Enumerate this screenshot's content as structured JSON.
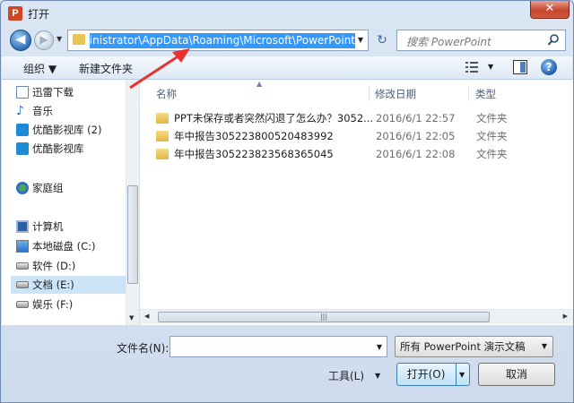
{
  "window": {
    "title": "打开",
    "app_icon_letter": "P",
    "close_symbol": "✕"
  },
  "nav": {
    "back_symbol": "◀",
    "forward_symbol": "▶",
    "address": "C:\\Users\\Administrator\\AppData\\Roaming\\Microsoft\\PowerPoint",
    "refresh_symbol": "↻",
    "search_placeholder": "搜索 PowerPoint"
  },
  "toolbar": {
    "organize_label": "组织 ▼",
    "new_folder_label": "新建文件夹",
    "help_symbol": "?"
  },
  "sidebar": {
    "items": [
      {
        "label": "迅雷下载",
        "icon": "document-icon"
      },
      {
        "label": "音乐",
        "icon": "music-icon"
      },
      {
        "label": "优酷影视库 (2)",
        "icon": "video-icon"
      },
      {
        "label": "优酷影视库",
        "icon": "video-icon"
      },
      {
        "label": "家庭组",
        "icon": "homegroup-icon"
      },
      {
        "label": "计算机",
        "icon": "computer-icon"
      },
      {
        "label": "本地磁盘 (C:)",
        "icon": "system-drive-icon"
      },
      {
        "label": "软件 (D:)",
        "icon": "drive-icon"
      },
      {
        "label": "文档 (E:)",
        "icon": "drive-icon",
        "selected": true
      },
      {
        "label": "娱乐 (F:)",
        "icon": "drive-icon"
      }
    ]
  },
  "filelist": {
    "columns": [
      "名称",
      "修改日期",
      "类型"
    ],
    "rows": [
      {
        "name": "PPT未保存或者突然闪退了怎么办？3052...",
        "date": "2016/6/1 22:57",
        "type": "文件夹"
      },
      {
        "name": "年中报告305223800520483992",
        "date": "2016/6/1 22:05",
        "type": "文件夹"
      },
      {
        "name": "年中报告305223823568365045",
        "date": "2016/6/1 22:08",
        "type": "文件夹"
      }
    ]
  },
  "bottom": {
    "filename_label": "文件名(N):",
    "filename_value": "",
    "filter_value": "所有 PowerPoint 演示文稿",
    "tools_label": "工具(L)",
    "open_label": "打开(O)",
    "cancel_label": "取消"
  },
  "colors": {
    "selection": "#3399ff",
    "annotation_arrow": "#e8322f"
  }
}
